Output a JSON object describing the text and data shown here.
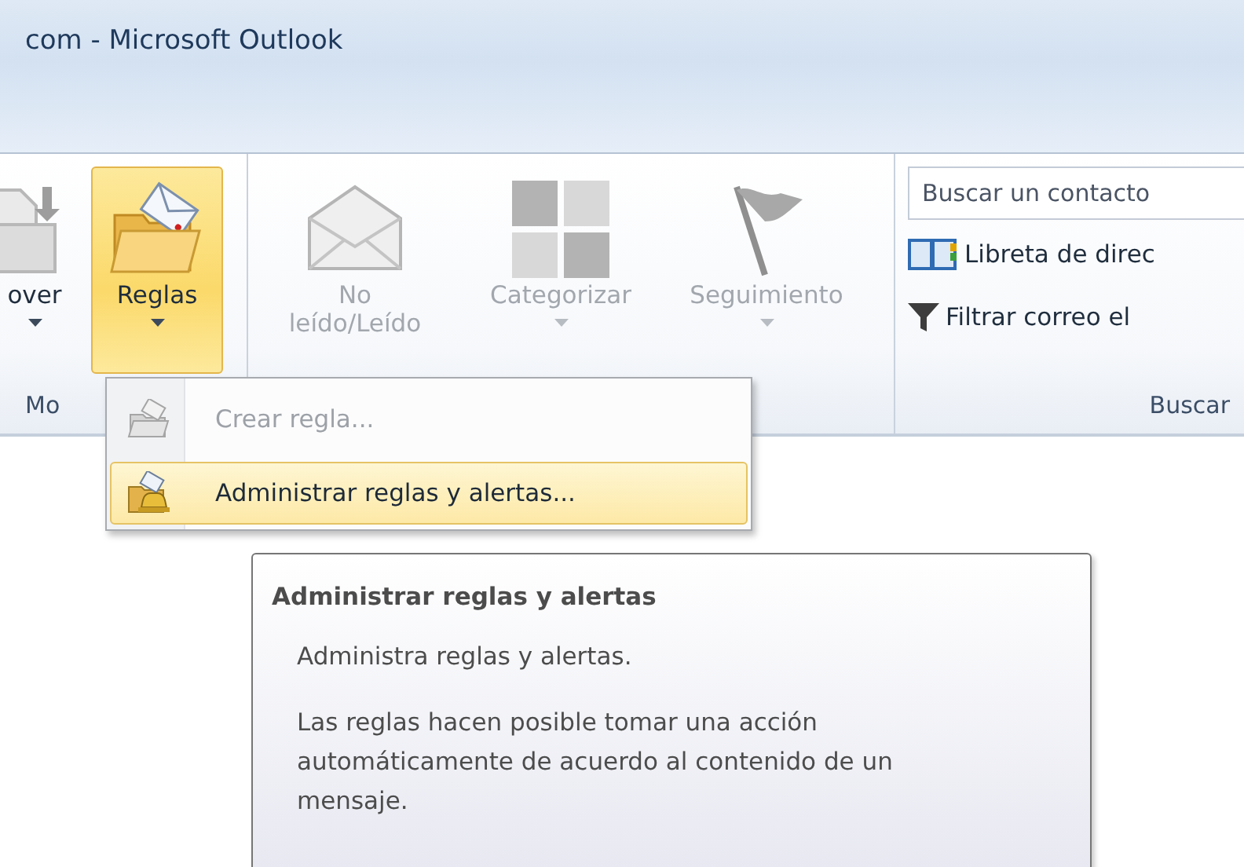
{
  "window": {
    "title": "com - Microsoft Outlook"
  },
  "ribbon": {
    "groups": [
      {
        "label": "Mo",
        "buttons": [
          {
            "kind": "move",
            "label": "over",
            "selected": false,
            "disabled": false,
            "dropdown": true
          },
          {
            "kind": "rules",
            "label": "Reglas",
            "selected": true,
            "disabled": false,
            "dropdown": true
          }
        ]
      },
      {
        "buttons": [
          {
            "kind": "unread",
            "label": "No leído/Leído",
            "selected": false,
            "disabled": true,
            "dropdown": false
          },
          {
            "kind": "categorize",
            "label": "Categorizar",
            "selected": false,
            "disabled": true,
            "dropdown": true
          },
          {
            "kind": "followup",
            "label": "Seguimiento",
            "selected": false,
            "disabled": true,
            "dropdown": true
          }
        ]
      },
      {
        "label": "Buscar",
        "search": {
          "placeholder": "Buscar un contacto"
        },
        "links": [
          {
            "kind": "addressbook",
            "label": "Libreta de direc"
          },
          {
            "kind": "filter",
            "label": "Filtrar correo el"
          }
        ]
      }
    ]
  },
  "menu": {
    "items": [
      {
        "kind": "create",
        "label": "Crear regla...",
        "disabled": true,
        "selected": false
      },
      {
        "kind": "manage",
        "label": "Administrar reglas y alertas...",
        "disabled": false,
        "selected": true
      }
    ]
  },
  "tooltip": {
    "title": "Administrar reglas y alertas",
    "paragraphs": [
      "Administra reglas y alertas.",
      "Las reglas hacen posible tomar una acción automáticamente de acuerdo al contenido de un mensaje."
    ]
  }
}
